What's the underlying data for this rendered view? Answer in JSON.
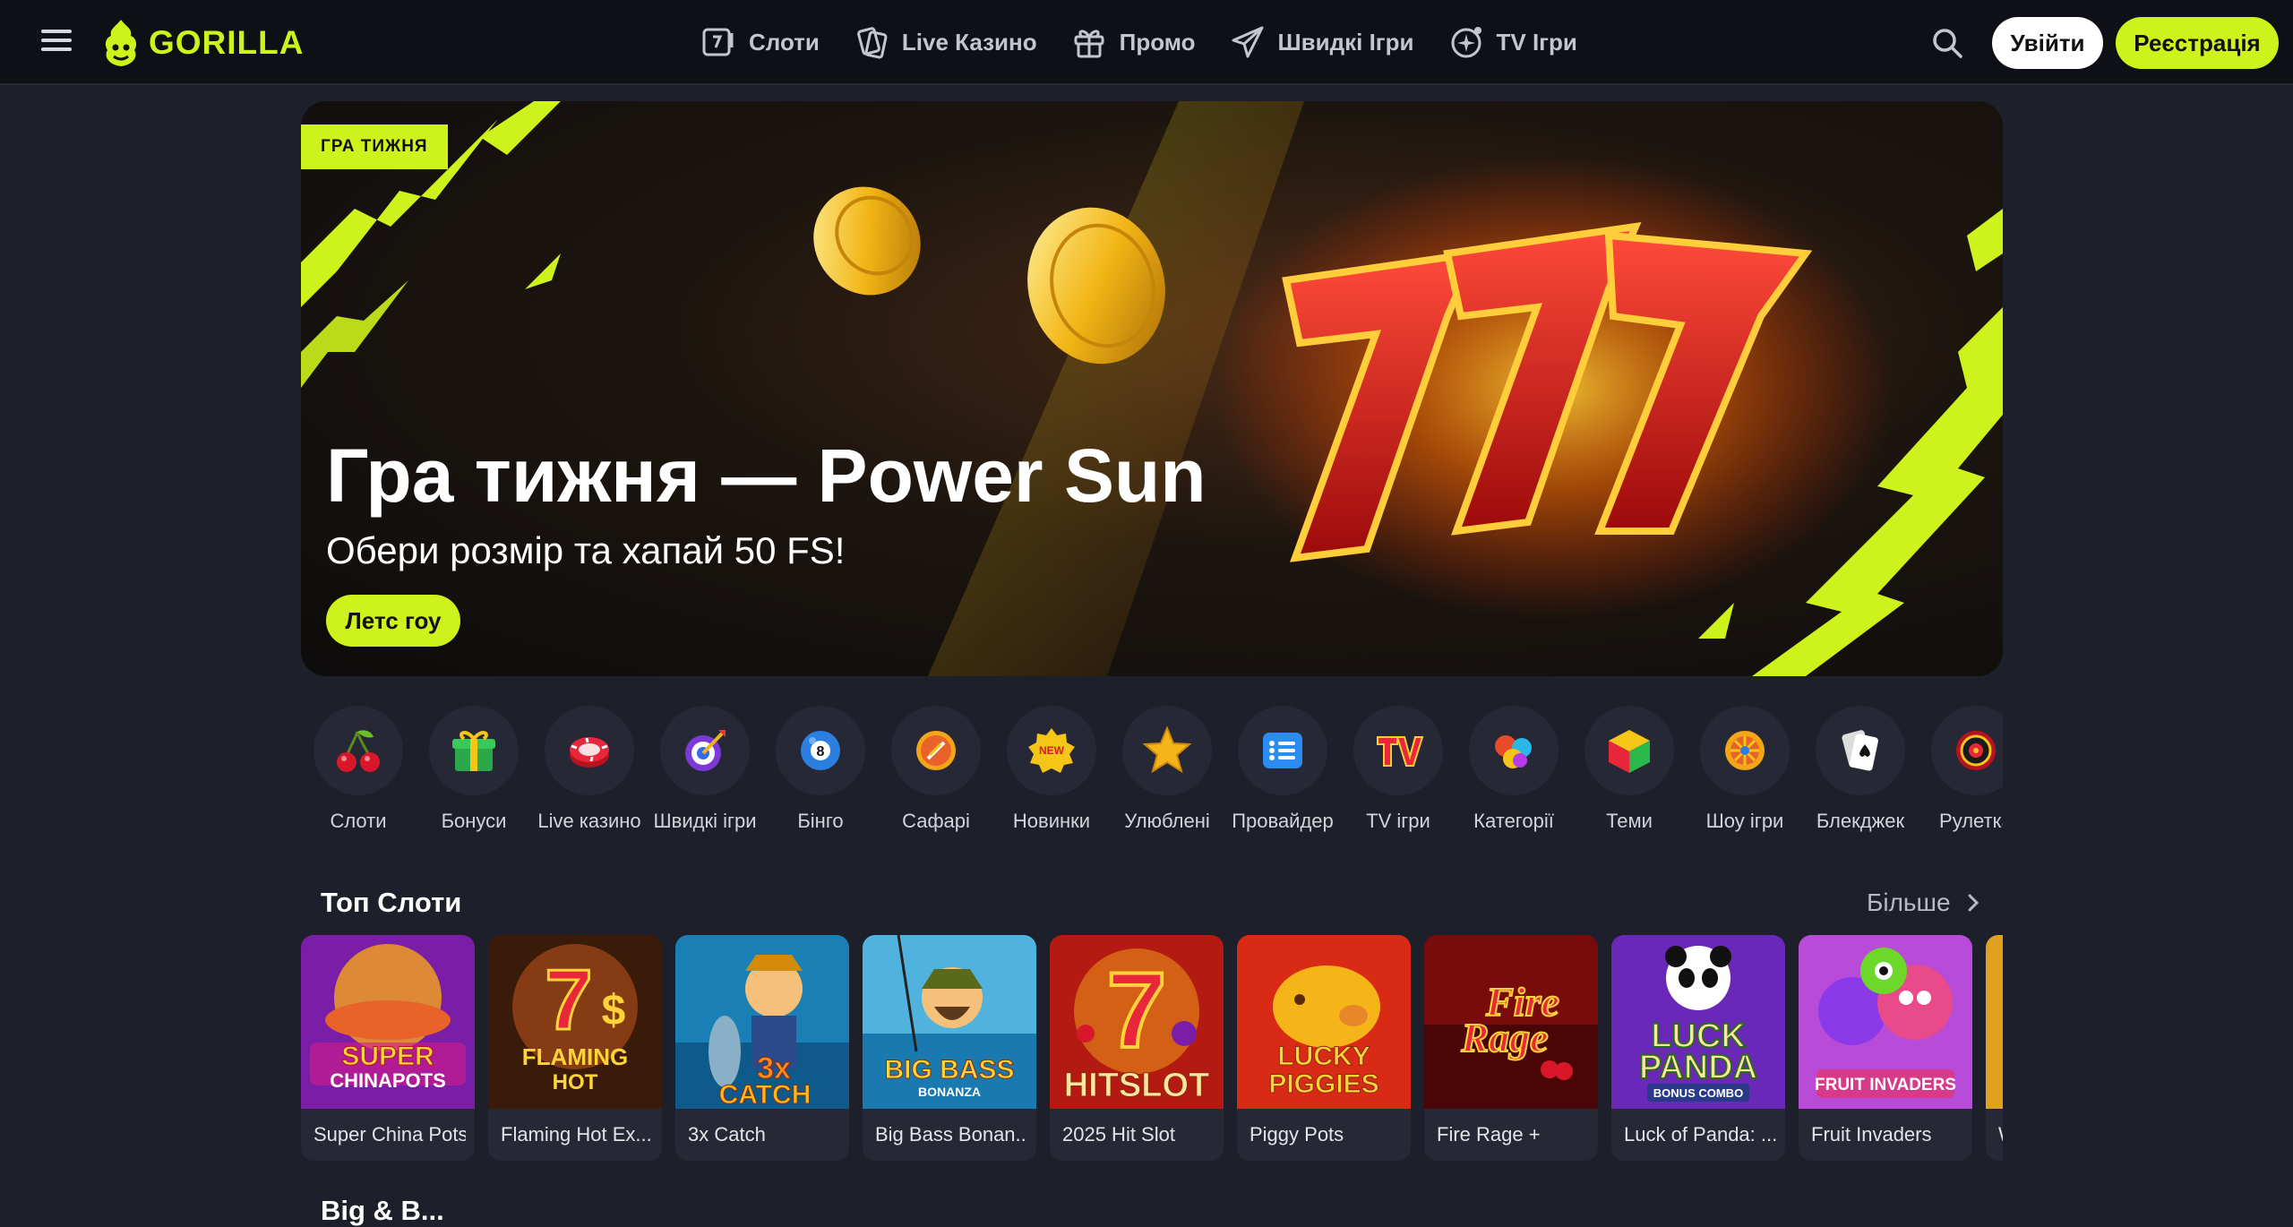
{
  "header": {
    "logo_text": "GORILLA",
    "nav": [
      {
        "label": "Слоти",
        "icon": "slot-machine-icon"
      },
      {
        "label": "Live Казино",
        "icon": "cards-icon"
      },
      {
        "label": "Промо",
        "icon": "gift-icon"
      },
      {
        "label": "Швидкі Ігри",
        "icon": "paper-plane-icon"
      },
      {
        "label": "TV Ігри",
        "icon": "sparkle-plus-icon"
      }
    ],
    "login_label": "Увійти",
    "register_label": "Реєстрація",
    "accent_color": "#cdf21c"
  },
  "hero": {
    "tag": "ГРА ТИЖНЯ",
    "title": "Гра тижня — Power Sun",
    "subtitle": "Обери розмір та хапай 50 FS!",
    "cta": "Летс гоу",
    "art_text": "777"
  },
  "categories": [
    {
      "label": "Слоти",
      "icon": "cherry-icon"
    },
    {
      "label": "Бонуси",
      "icon": "gift-box-icon"
    },
    {
      "label": "Live казино",
      "icon": "poker-chip-icon"
    },
    {
      "label": "Швидкі ігри",
      "icon": "target-dart-icon"
    },
    {
      "label": "Бінго",
      "icon": "bingo-ball-icon"
    },
    {
      "label": "Сафарі",
      "icon": "safari-badge-icon"
    },
    {
      "label": "Новинки",
      "icon": "new-badge-icon"
    },
    {
      "label": "Улюблені",
      "icon": "star-icon"
    },
    {
      "label": "Провайдер",
      "icon": "list-icon"
    },
    {
      "label": "TV ігри",
      "icon": "tv-icon"
    },
    {
      "label": "Категорії",
      "icon": "balls-icon"
    },
    {
      "label": "Теми",
      "icon": "cube-icon"
    },
    {
      "label": "Шоу ігри",
      "icon": "wheel-icon"
    },
    {
      "label": "Блекджек",
      "icon": "cards-spade-icon"
    },
    {
      "label": "Рулетка",
      "icon": "roulette-icon"
    }
  ],
  "top_slots": {
    "title": "Топ Слоти",
    "more": "Більше",
    "games": [
      {
        "name": "Super China Pots",
        "art_text": "SUPER CHINAPOTS",
        "bg": "#7a1ea8"
      },
      {
        "name": "Flaming Hot Ex...",
        "art_text": "FLAMING HOT",
        "bg": "#3a1a08"
      },
      {
        "name": "3x Catch",
        "art_text": "3x CATCH",
        "bg": "#1a7fb5"
      },
      {
        "name": "Big Bass Bonan...",
        "art_text": "BIG BASS",
        "bg": "#4fb3dd"
      },
      {
        "name": "2025 Hit Slot",
        "art_text": "HITSLOT",
        "bg": "#b21a12"
      },
      {
        "name": "Piggy Pots",
        "art_text": "LUCKY PIGGIES",
        "bg": "#d82a14"
      },
      {
        "name": "Fire Rage +",
        "art_text": "Fire Rage",
        "bg": "#7a0b0b"
      },
      {
        "name": "Luck of Panda: ...",
        "art_text": "LUCK PANDA",
        "bg": "#6a28b8"
      },
      {
        "name": "Fruit Invaders",
        "art_text": "FRUIT INVADERS",
        "bg": "#b84bd8"
      },
      {
        "name": "W",
        "art_text": "",
        "bg": "#e0a020"
      }
    ]
  },
  "next_section": {
    "title": "Big & B..."
  }
}
